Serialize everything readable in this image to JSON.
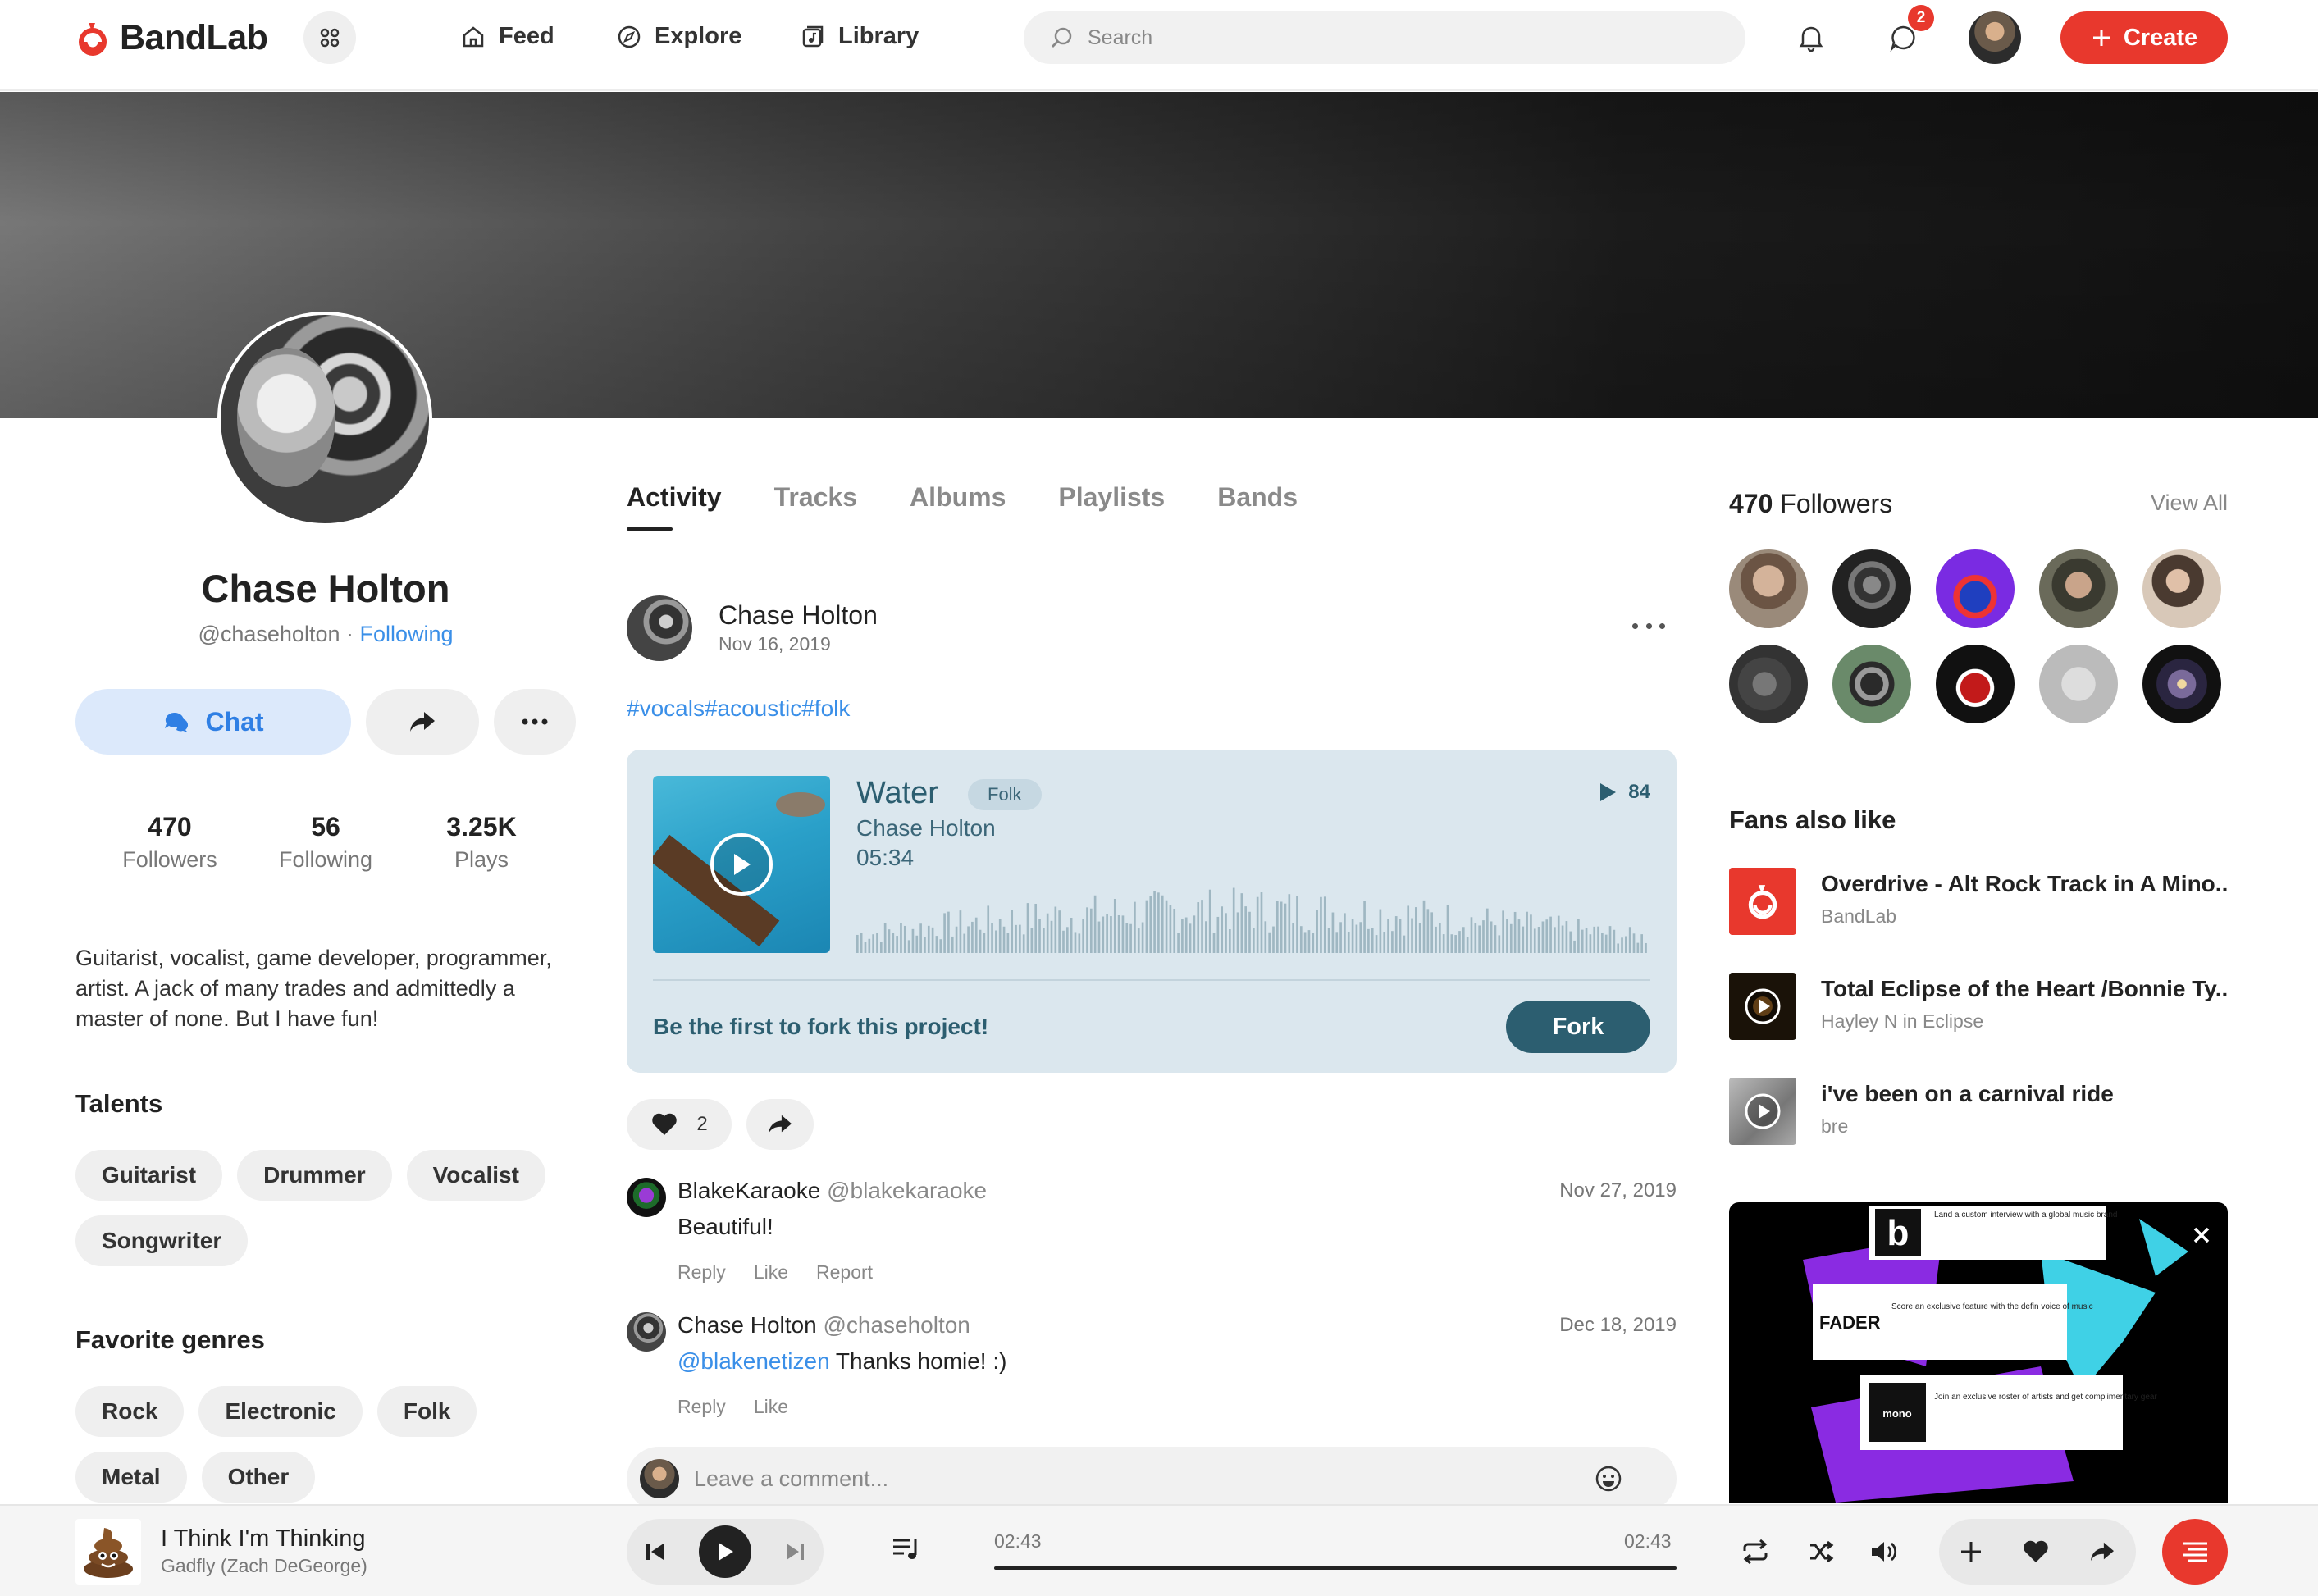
{
  "colors": {
    "brand": "#e8382d",
    "link": "#3a8fe8",
    "card": "#dbe7ee",
    "card_accent": "#2c5e70"
  },
  "header": {
    "logo_text": "BandLab",
    "nav": [
      {
        "label": "Feed",
        "icon": "home-icon"
      },
      {
        "label": "Explore",
        "icon": "compass-icon"
      },
      {
        "label": "Library",
        "icon": "library-icon"
      }
    ],
    "search_placeholder": "Search",
    "messages_badge": "2",
    "create_label": "Create"
  },
  "profile": {
    "name": "Chase Holton",
    "handle": "@chaseholton",
    "separator": " · ",
    "follow_status": "Following",
    "chat_label": "Chat",
    "stats": [
      {
        "value": "470",
        "label": "Followers"
      },
      {
        "value": "56",
        "label": "Following"
      },
      {
        "value": "3.25K",
        "label": "Plays"
      }
    ],
    "bio": "Guitarist, vocalist, game developer, programmer, artist. A jack of many trades and admittedly a master of none. But I have fun!",
    "talents_title": "Talents",
    "talents": [
      "Guitarist",
      "Drummer",
      "Vocalist",
      "Songwriter"
    ],
    "genres_title": "Favorite genres",
    "genres": [
      "Rock",
      "Electronic",
      "Folk",
      "Metal",
      "Other"
    ]
  },
  "tabs": [
    {
      "label": "Activity",
      "active": true
    },
    {
      "label": "Tracks"
    },
    {
      "label": "Albums"
    },
    {
      "label": "Playlists"
    },
    {
      "label": "Bands"
    }
  ],
  "post": {
    "author": "Chase Holton",
    "date": "Nov 16, 2019",
    "tags": "#vocals#acoustic#folk",
    "track": {
      "title": "Water",
      "genre": "Folk",
      "artist": "Chase Holton",
      "duration": "05:34",
      "plays": "84"
    },
    "fork_prompt": "Be the first to fork this project!",
    "fork_label": "Fork",
    "likes": "2"
  },
  "comments": [
    {
      "name": "BlakeKaraoke",
      "handle": "@blakekaraoke",
      "date": "Nov 27, 2019",
      "mention": "",
      "text": "Beautiful!",
      "actions": [
        "Reply",
        "Like",
        "Report"
      ]
    },
    {
      "name": "Chase Holton",
      "handle": "@chaseholton",
      "date": "Dec 18, 2019",
      "mention": "@blakenetizen",
      "text": " Thanks homie! :)",
      "actions": [
        "Reply",
        "Like"
      ]
    }
  ],
  "comment_placeholder": "Leave a comment...",
  "sidebar": {
    "followers_count": "470",
    "followers_label": " Followers",
    "view_all": "View All",
    "fans_title": "Fans also like",
    "fans": [
      {
        "title": "Overdrive - Alt Rock Track in A Mino...",
        "subtitle": "BandLab"
      },
      {
        "title": "Total Eclipse of the Heart /Bonnie Ty...",
        "subtitle": "Hayley N in Eclipse"
      },
      {
        "title": "i've been on a carnival ride",
        "subtitle": "bre"
      }
    ],
    "ad": {
      "brand1": "b",
      "brand2": "FADER",
      "brand3": "mono",
      "line1": "Land a custom interview with a global music brand",
      "line2": "Score an exclusive feature with the defin voice of music",
      "line3": "Join an exclusive roster of artists and get complimentary gear"
    }
  },
  "player": {
    "title": "I Think I'm Thinking",
    "artist": "Gadfly (Zach DeGeorge)",
    "elapsed": "02:43",
    "total": "02:43",
    "progress": 1.0
  }
}
